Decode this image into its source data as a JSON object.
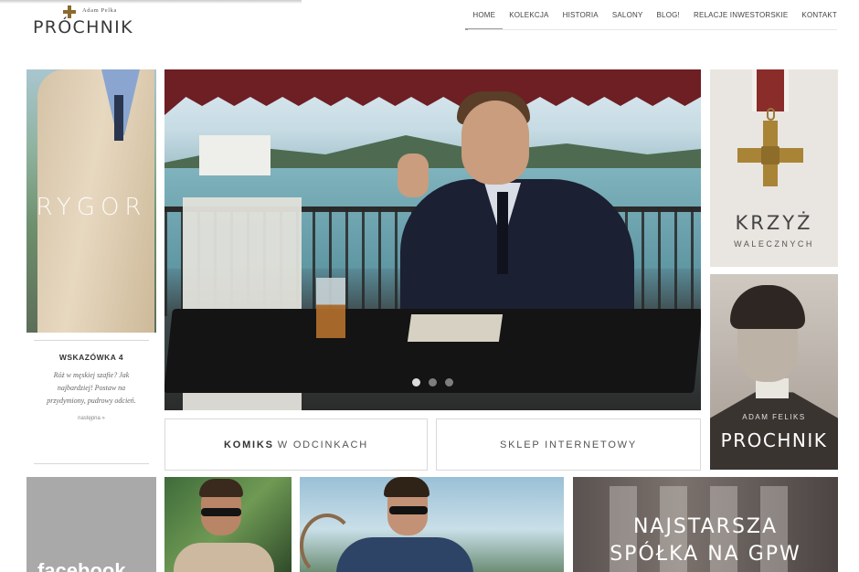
{
  "header": {
    "logo_sub": "Adam Pelka",
    "logo_name": "PRÓCHNIK",
    "nav": [
      "HOME",
      "KOLEKCJA",
      "HISTORIA",
      "SALONY",
      "BLOG!",
      "RELACJE INWESTORSKIE",
      "KONTAKT"
    ],
    "active_nav": "HOME"
  },
  "tiles": {
    "rygor_label": "RYGOR",
    "tip_title": "WSKAZÓWKA 4",
    "tip_text": "Róż w męskiej szafie? Jak najbardziej! Postaw na przydymiony, pudrowy odcień.",
    "tip_more": "następna »",
    "box1_bold": "KOMIKS",
    "box1_rest": "W ODCINKACH",
    "box2": "SKLEP INTERNETOWY",
    "krzyz_title": "KRZYŻ",
    "krzyz_sub": "WALECZNYCH",
    "portrait_small": "ADAM FELIKS",
    "portrait_big": "PROCHNIK",
    "facebook": "facebook",
    "gpw_line1": "NAJSTARSZA",
    "gpw_line2": "SPÓŁKA NA GPW"
  },
  "slider": {
    "count": 3,
    "active": 1
  },
  "colors": {
    "awning": "#6d1f24",
    "cross_gold": "#a98436",
    "ribbon_red": "#8a2c2a"
  }
}
